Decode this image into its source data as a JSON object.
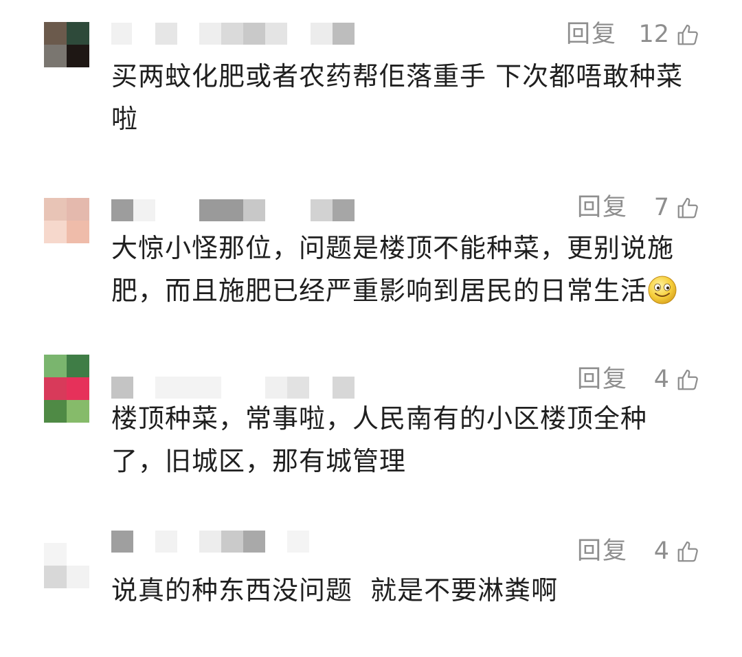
{
  "comments": [
    {
      "reply_label": "回复",
      "likes": "12",
      "text": "买两蚊化肥或者农药帮佢落重手 下次都唔敢种菜啦"
    },
    {
      "reply_label": "回复",
      "likes": "7",
      "text": "大惊小怪那位，问题是楼顶不能种菜，更别说施肥，而且施肥已经严重影响到居民的日常生活",
      "emoji": "smile-emoji"
    },
    {
      "reply_label": "回复",
      "likes": "4",
      "text": "楼顶种菜，常事啦，人民南有的小区楼顶全种了，旧城区，那有城管理"
    },
    {
      "reply_label": "回复",
      "likes": "4",
      "text": "说真的种东西没问题  就是不要淋粪啊"
    }
  ],
  "icons": {
    "like": "thumbs-up-icon"
  },
  "colors": {
    "text": "#1f1f1f",
    "meta": "#8e8e8e"
  }
}
